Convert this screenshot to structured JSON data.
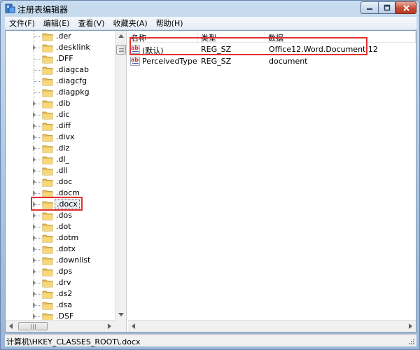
{
  "window": {
    "title": "注册表编辑器",
    "icon": "regedit-icon"
  },
  "menubar": {
    "items": [
      {
        "label": "文件(F)"
      },
      {
        "label": "编辑(E)"
      },
      {
        "label": "查看(V)"
      },
      {
        "label": "收藏夹(A)"
      },
      {
        "label": "帮助(H)"
      }
    ]
  },
  "tree": {
    "items": [
      {
        "label": ".der",
        "expandable": false
      },
      {
        "label": ".desklink",
        "expandable": true
      },
      {
        "label": ".DFF",
        "expandable": false
      },
      {
        "label": ".diagcab",
        "expandable": false
      },
      {
        "label": ".diagcfg",
        "expandable": false
      },
      {
        "label": ".diagpkg",
        "expandable": false
      },
      {
        "label": ".dib",
        "expandable": true
      },
      {
        "label": ".dic",
        "expandable": true
      },
      {
        "label": ".diff",
        "expandable": true
      },
      {
        "label": ".divx",
        "expandable": true
      },
      {
        "label": ".diz",
        "expandable": true
      },
      {
        "label": ".dl_",
        "expandable": true
      },
      {
        "label": ".dll",
        "expandable": true
      },
      {
        "label": ".doc",
        "expandable": true
      },
      {
        "label": ".docm",
        "expandable": true
      },
      {
        "label": ".docx",
        "expandable": true,
        "selected": true
      },
      {
        "label": ".dos",
        "expandable": true
      },
      {
        "label": ".dot",
        "expandable": true
      },
      {
        "label": ".dotm",
        "expandable": true
      },
      {
        "label": ".dotx",
        "expandable": true
      },
      {
        "label": ".downlist",
        "expandable": true
      },
      {
        "label": ".dps",
        "expandable": true
      },
      {
        "label": ".drv",
        "expandable": true
      },
      {
        "label": ".ds2",
        "expandable": true
      },
      {
        "label": ".dsa",
        "expandable": true
      },
      {
        "label": ".DSF",
        "expandable": true
      }
    ]
  },
  "values": {
    "columns": {
      "name": "名称",
      "type": "类型",
      "data": "数据"
    },
    "rows": [
      {
        "name": "(默认)",
        "type": "REG_SZ",
        "data": "Office12.Word.Document.12"
      },
      {
        "name": "PerceivedType",
        "type": "REG_SZ",
        "data": "document"
      }
    ]
  },
  "statusbar": {
    "path": "计算机\\HKEY_CLASSES_ROOT\\.docx"
  },
  "colors": {
    "highlight": "#e23232",
    "folder": "#e8c15a"
  }
}
